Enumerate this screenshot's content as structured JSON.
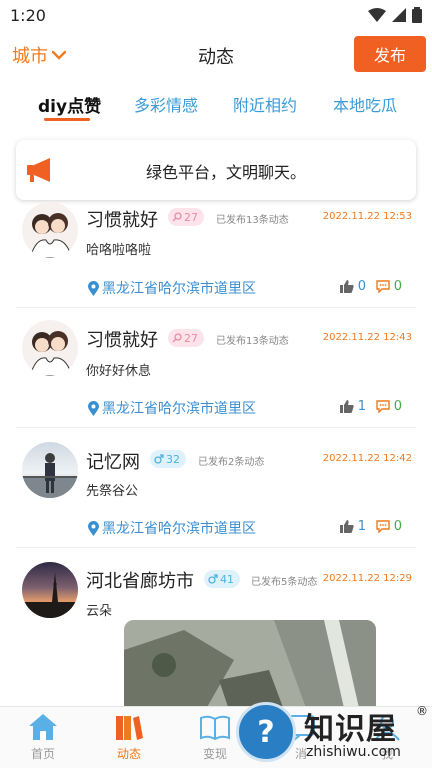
{
  "status_bar": {
    "time": "1:20"
  },
  "header": {
    "city_label": "城市",
    "title": "动态",
    "publish_label": "发布"
  },
  "tabs": [
    {
      "label": "diy点赞",
      "active": true
    },
    {
      "label": "多彩情感",
      "active": false
    },
    {
      "label": "附近相约",
      "active": false
    },
    {
      "label": "本地吃瓜",
      "active": false
    }
  ],
  "notice": {
    "text": "绿色平台，文明聊天。"
  },
  "posts": [
    {
      "username": "习惯就好",
      "gender": "female",
      "age": "27",
      "post_count": "已发布13条动态",
      "time": "2022.11.22 12:53",
      "text": "哈咯啦咯啦",
      "location": "黑龙江省哈尔滨市道里区",
      "likes": "0",
      "comments": "0"
    },
    {
      "username": "习惯就好",
      "gender": "female",
      "age": "27",
      "post_count": "已发布13条动态",
      "time": "2022.11.22 12:43",
      "text": "你好好休息",
      "location": "黑龙江省哈尔滨市道里区",
      "likes": "1",
      "comments": "0"
    },
    {
      "username": "记忆网",
      "gender": "male",
      "age": "32",
      "post_count": "已发布2条动态",
      "time": "2022.11.22 12:42",
      "text": "先祭谷公",
      "location": "黑龙江省哈尔滨市道里区",
      "likes": "1",
      "comments": "0"
    },
    {
      "username": "河北省廊坊市",
      "gender": "male",
      "age": "41",
      "post_count": "已发布5条动态",
      "time": "2022.11.22 12:29",
      "text": "云朵"
    }
  ],
  "bottom_nav": [
    {
      "label": "首页",
      "icon": "home-icon",
      "active": false
    },
    {
      "label": "动态",
      "icon": "books-icon",
      "active": true
    },
    {
      "label": "变现",
      "icon": "book-open-icon",
      "active": false
    },
    {
      "label": "消",
      "icon": "message-icon",
      "active": false
    },
    {
      "label": "我",
      "icon": "user-icon",
      "active": false
    }
  ],
  "watermark": {
    "title": "知识屋",
    "registered": "®",
    "subtitle": "zhishiwu.com"
  },
  "colors": {
    "accent": "#f07a1e",
    "publish_bg": "#f06022",
    "tab_inactive": "#3a9bd6",
    "location": "#3a8fd0",
    "comment": "#3fae3f"
  }
}
